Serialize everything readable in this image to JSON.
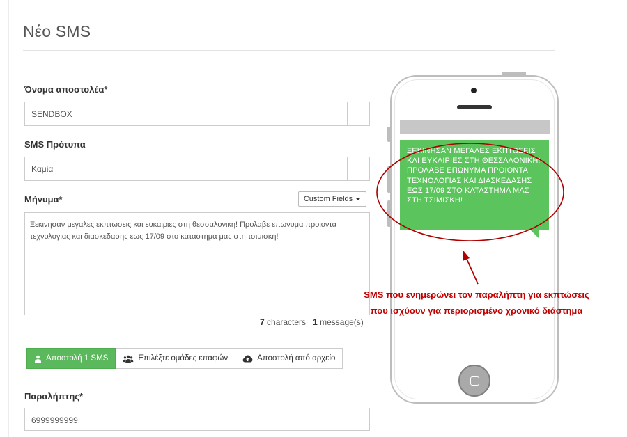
{
  "page": {
    "title": "Νέο SMS"
  },
  "sender": {
    "label": "Όνομα αποστολέα*",
    "value": "SENDBOX"
  },
  "template": {
    "label": "SMS Πρότυπα",
    "value": "Καμία"
  },
  "message": {
    "label": "Μήνυμα*",
    "custom_fields_label": "Custom Fields",
    "text": "Ξεκινησαν μεγαλες εκπτωσεις και ευκαιριες στη θεσσαλονικη! Προλαβε επωνυμα προιοντα τεχνολογιας και διασκεδασης εως 17/09 στο καταστημα μας στη τσιμισκη!",
    "char_count": "7",
    "char_label": "characters",
    "msg_count": "1",
    "msg_label": "message(s)"
  },
  "send_options": {
    "single_label": "Αποστολή 1 SMS",
    "groups_label": "Επιλέξτε ομάδες επαφών",
    "file_label": "Αποστολή από αρχείο"
  },
  "recipient": {
    "label": "Παραλήπτης*",
    "value": "6999999999"
  },
  "phone_preview": {
    "sms_text": "ΞΕΚΙΝΗΣΑΝ ΜΕΓΑΛΕΣ ΕΚΠΤΩΣΕΙΣ ΚΑΙ ΕΥΚΑΙΡΙΕΣ ΣΤΗ ΘΕΣΣΑΛΟΝΙΚΗ! ΠΡΟΛΑΒΕ ΕΠΩΝΥΜΑ ΠΡΟΙΟΝΤΑ ΤΕΧΝΟΛΟΓΙΑΣ ΚΑΙ ΔΙΑΣΚΕΔΑΣΗΣ ΕΩΣ 17/09 ΣΤΟ ΚΑΤΑΣΤΗΜΑ ΜΑΣ ΣΤΗ ΤΣΙΜΙΣΚΗ!"
  },
  "annotation": {
    "text": "SMS που ενημερώνει τον παραλήπτη για εκπτώσεις που ισχύουν για περιορισμένο χρονικό διάστημα"
  },
  "colors": {
    "accent_green": "#5cb85c",
    "bubble_green": "#5cc45c",
    "annotation_red": "#c00000"
  },
  "icons": {
    "single_send": "user-icon",
    "groups": "users-icon",
    "file": "cloud-upload-icon"
  }
}
